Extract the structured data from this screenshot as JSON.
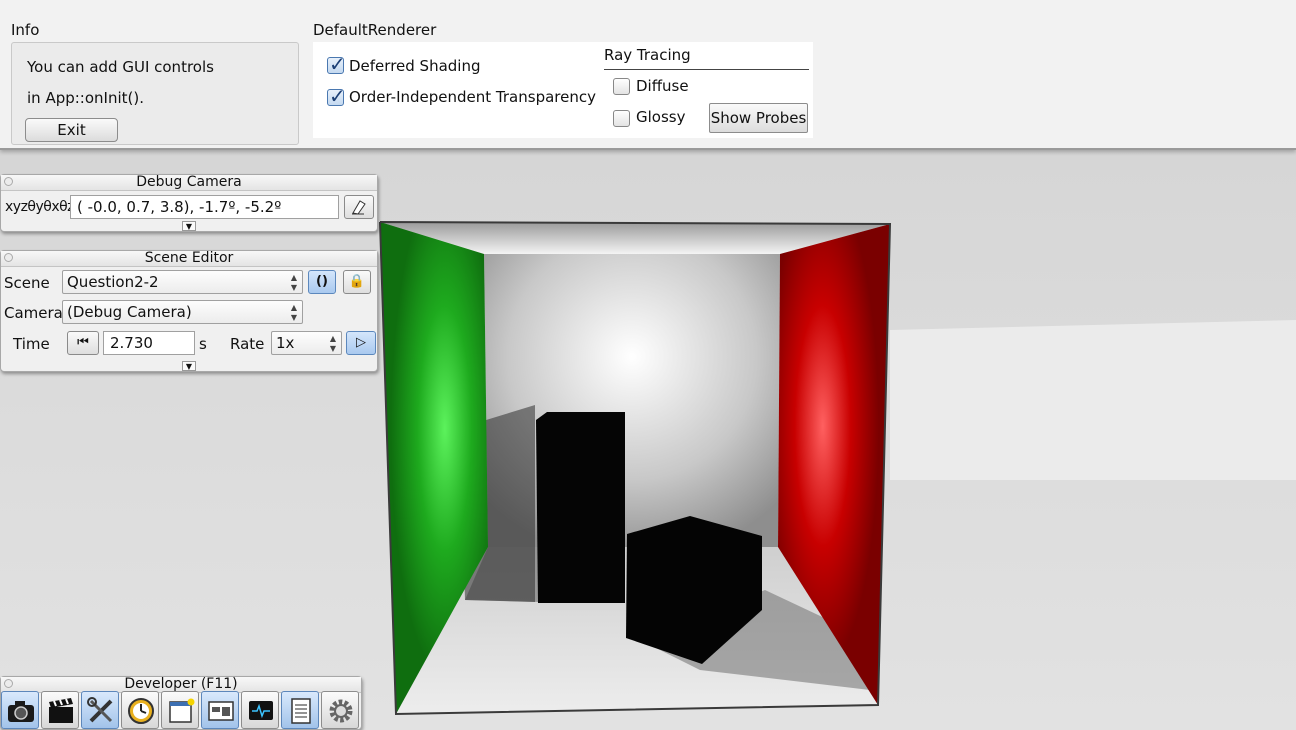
{
  "info": {
    "title": "Info",
    "line1": "You can add GUI controls",
    "line2": "in App::onInit().",
    "exit_label": "Exit"
  },
  "renderer": {
    "title": "DefaultRenderer",
    "deferred_shading": {
      "label": "Deferred Shading",
      "checked": true
    },
    "oit": {
      "label": "Order-Independent Transparency",
      "checked": true
    },
    "ray_tracing": {
      "title": "Ray Tracing",
      "diffuse": {
        "label": "Diffuse",
        "checked": false
      },
      "glossy": {
        "label": "Glossy",
        "checked": false
      },
      "show_probes_label": "Show Probes"
    }
  },
  "debug_camera": {
    "title": "Debug Camera",
    "label": "xyzθyθxθz",
    "value": "( -0.0,   0.7,   3.8),  -1.7º,  -5.2º"
  },
  "scene_editor": {
    "title": "Scene Editor",
    "scene_label": "Scene",
    "scene_value": "Question2-2",
    "camera_label": "Camera",
    "camera_value": "(Debug Camera)",
    "time_label": "Time",
    "time_value": "2.730",
    "time_unit": "s",
    "rate_label": "Rate",
    "rate_value": "1x",
    "reload_icon_text": "()",
    "lock_icon_text": "🔒",
    "play_icon_text": "▷",
    "rewind_icon_text": "⏮"
  },
  "developer": {
    "title": "Developer (F11)",
    "tools": [
      "camera-icon",
      "clapperboard-icon",
      "tools-icon",
      "clock-icon",
      "window-icon",
      "layout-icon",
      "monitor-icon",
      "document-icon",
      "gear-icon"
    ]
  },
  "colors": {
    "left_wall": "#1aa01a",
    "right_wall": "#c00000",
    "box": "#050505",
    "active_button": "#a9c9ef"
  }
}
